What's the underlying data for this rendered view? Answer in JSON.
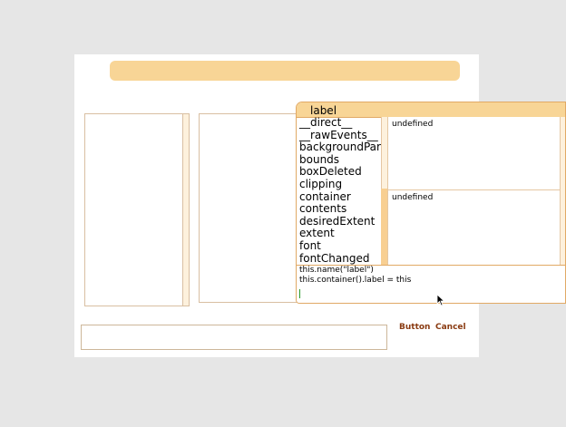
{
  "dialog": {
    "button_label": "Button",
    "cancel_label": "Cancel"
  },
  "inspector": {
    "title": "label",
    "fields": [
      "__direct__",
      "__rawEvents__",
      "backgroundPar",
      "bounds",
      "boxDeleted",
      "clipping",
      "container",
      "contents",
      "desiredExtent",
      "extent",
      "font",
      "fontChanged"
    ],
    "value_top": "undefined",
    "value_bottom": "undefined",
    "code_lines": [
      "this.name(\"label\")",
      "this.container().label = this"
    ]
  },
  "colors": {
    "accent": "#f8d596",
    "border": "#e1a965",
    "button_text": "#8a3b12"
  },
  "icons": {
    "cursor": "arrow-pointer-icon"
  }
}
